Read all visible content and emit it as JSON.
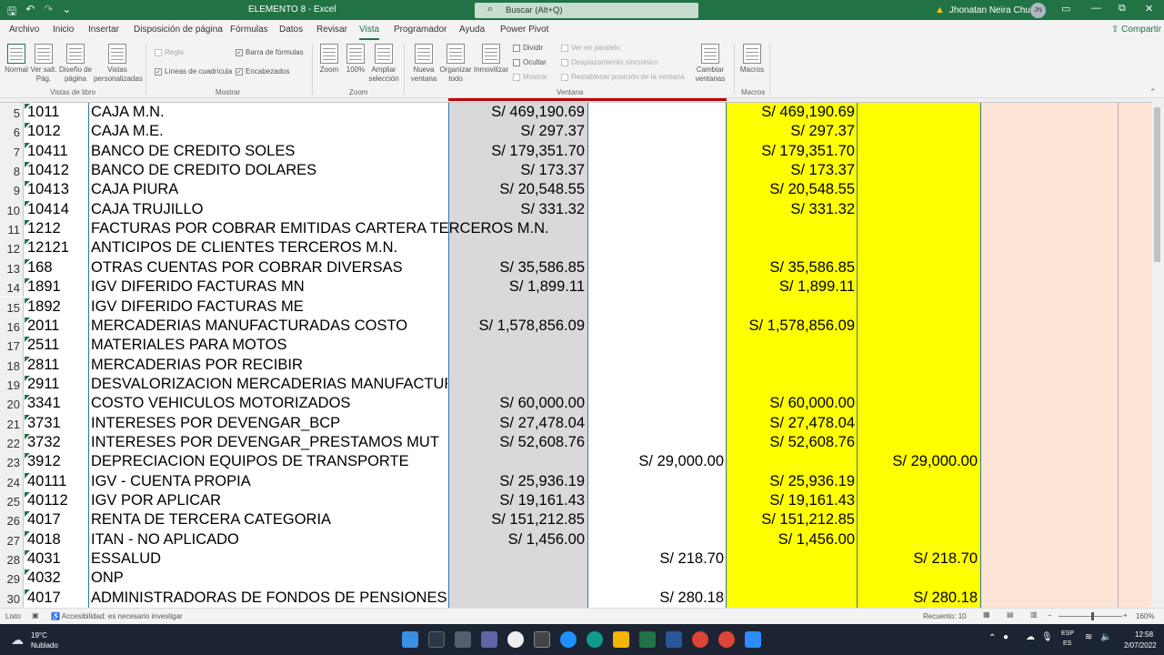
{
  "window": {
    "title": "ELEMENTO 8  -  Excel",
    "search_placeholder": "Buscar (Alt+Q)",
    "user_name": "Jhonatan Neira Chucas",
    "user_initials": "JN",
    "minimize": "—",
    "restore": "⧉",
    "close": "✕"
  },
  "menu": {
    "tabs": [
      "Archivo",
      "Inicio",
      "Insertar",
      "Disposición de página",
      "Fórmulas",
      "Datos",
      "Revisar",
      "Vista",
      "Programador",
      "Ayuda",
      "Power Pivot"
    ],
    "active": "Vista",
    "share": "Compartir"
  },
  "ribbon": {
    "vistas": {
      "normal": "Normal",
      "salto": "Ver salt. Pág.",
      "diseno": "Diseño de página",
      "personalizadas": "Vistas personalizadas",
      "group": "Vistas de libro"
    },
    "mostrar": {
      "regla": "Regla",
      "barra": "Barra de fórmulas",
      "lineas": "Líneas de cuadrícula",
      "encabezados": "Encabezados",
      "group": "Mostrar"
    },
    "zoom": {
      "zoom": "Zoom",
      "cien": "100%",
      "ampliar": "Ampliar selección",
      "group": "Zoom"
    },
    "ventana": {
      "nueva": "Nueva ventana",
      "organizar": "Organizar todo",
      "inmovilizar": "Inmovilizar",
      "dividir": "Dividir",
      "ocultar": "Ocultar",
      "mostrar": "Mostrar",
      "paralelo": "Ver en paralelo",
      "desplazamiento": "Desplazamiento sincrónico",
      "restablecer": "Restablecer posición de la ventana",
      "cambiar": "Cambiar ventanas",
      "group": "Ventana"
    },
    "macros": {
      "macros": "Macros",
      "group": "Macros"
    }
  },
  "rows": [
    {
      "n": "5",
      "code": "1011",
      "desc": "CAJA M.N.",
      "debe": "S/ 469,190.69",
      "haber": "",
      "saldo_d": "S/ 469,190.69",
      "saldo_h": ""
    },
    {
      "n": "6",
      "code": "1012",
      "desc": "CAJA M.E.",
      "debe": "S/ 297.37",
      "haber": "",
      "saldo_d": "S/ 297.37",
      "saldo_h": ""
    },
    {
      "n": "7",
      "code": "10411",
      "desc": "BANCO DE CREDITO SOLES",
      "debe": "S/ 179,351.70",
      "haber": "",
      "saldo_d": "S/ 179,351.70",
      "saldo_h": ""
    },
    {
      "n": "8",
      "code": "10412",
      "desc": "BANCO DE CREDITO DOLARES",
      "debe": "S/ 173.37",
      "haber": "",
      "saldo_d": "S/ 173.37",
      "saldo_h": ""
    },
    {
      "n": "9",
      "code": "10413",
      "desc": "CAJA PIURA",
      "debe": "S/ 20,548.55",
      "haber": "",
      "saldo_d": "S/ 20,548.55",
      "saldo_h": ""
    },
    {
      "n": "10",
      "code": "10414",
      "desc": "CAJA TRUJILLO",
      "debe": "S/ 331.32",
      "haber": "",
      "saldo_d": "S/ 331.32",
      "saldo_h": ""
    },
    {
      "n": "11",
      "code": "1212",
      "desc": "FACTURAS POR COBRAR EMITIDAS CARTERA TERCEROS M.N.",
      "debe": "",
      "haber": "",
      "saldo_d": "",
      "saldo_h": ""
    },
    {
      "n": "12",
      "code": "12121",
      "desc": "ANTICIPOS DE CLIENTES TERCEROS M.N.",
      "debe": "",
      "haber": "",
      "saldo_d": "",
      "saldo_h": ""
    },
    {
      "n": "13",
      "code": "168",
      "desc": "OTRAS CUENTAS POR COBRAR DIVERSAS",
      "debe": "S/ 35,586.85",
      "haber": "",
      "saldo_d": "S/ 35,586.85",
      "saldo_h": ""
    },
    {
      "n": "14",
      "code": "1891",
      "desc": "IGV DIFERIDO FACTURAS MN",
      "debe": "S/ 1,899.11",
      "haber": "",
      "saldo_d": "S/ 1,899.11",
      "saldo_h": ""
    },
    {
      "n": "15",
      "code": "1892",
      "desc": "IGV DIFERIDO FACTURAS ME",
      "debe": "",
      "haber": "",
      "saldo_d": "",
      "saldo_h": ""
    },
    {
      "n": "16",
      "code": "2011",
      "desc": "MERCADERIAS MANUFACTURADAS COSTO",
      "debe": "S/ 1,578,856.09",
      "haber": "",
      "saldo_d": "S/ 1,578,856.09",
      "saldo_h": ""
    },
    {
      "n": "17",
      "code": "2511",
      "desc": "MATERIALES PARA MOTOS",
      "debe": "",
      "haber": "",
      "saldo_d": "",
      "saldo_h": ""
    },
    {
      "n": "18",
      "code": "2811",
      "desc": "MERCADERIAS POR RECIBIR",
      "debe": "",
      "haber": "",
      "saldo_d": "",
      "saldo_h": ""
    },
    {
      "n": "19",
      "code": "2911",
      "desc": "DESVALORIZACION MERCADERIAS MANUFACTURADAS",
      "debe": "",
      "haber": "",
      "saldo_d": "",
      "saldo_h": ""
    },
    {
      "n": "20",
      "code": "3341",
      "desc": "COSTO VEHICULOS MOTORIZADOS",
      "debe": "S/ 60,000.00",
      "haber": "",
      "saldo_d": "S/ 60,000.00",
      "saldo_h": ""
    },
    {
      "n": "21",
      "code": "3731",
      "desc": "INTERESES POR DEVENGAR_BCP",
      "debe": "S/ 27,478.04",
      "haber": "",
      "saldo_d": "S/ 27,478.04",
      "saldo_h": ""
    },
    {
      "n": "22",
      "code": "3732",
      "desc": "INTERESES POR DEVENGAR_PRESTAMOS MUT",
      "debe": "S/ 52,608.76",
      "haber": "",
      "saldo_d": "S/ 52,608.76",
      "saldo_h": ""
    },
    {
      "n": "23",
      "code": "3912",
      "desc": "DEPRECIACION EQUIPOS DE TRANSPORTE",
      "debe": "",
      "haber": "S/ 29,000.00",
      "saldo_d": "",
      "saldo_h": "S/ 29,000.00"
    },
    {
      "n": "24",
      "code": "40111",
      "desc": "IGV - CUENTA PROPIA",
      "debe": "S/ 25,936.19",
      "haber": "",
      "saldo_d": "S/ 25,936.19",
      "saldo_h": ""
    },
    {
      "n": "25",
      "code": "40112",
      "desc": "IGV POR APLICAR",
      "debe": "S/ 19,161.43",
      "haber": "",
      "saldo_d": "S/ 19,161.43",
      "saldo_h": ""
    },
    {
      "n": "26",
      "code": "4017",
      "desc": "RENTA DE TERCERA CATEGORIA",
      "debe": "S/ 151,212.85",
      "haber": "",
      "saldo_d": "S/ 151,212.85",
      "saldo_h": ""
    },
    {
      "n": "27",
      "code": "4018",
      "desc": "ITAN - NO APLICADO",
      "debe": "S/ 1,456.00",
      "haber": "",
      "saldo_d": "S/ 1,456.00",
      "saldo_h": ""
    },
    {
      "n": "28",
      "code": "4031",
      "desc": "ESSALUD",
      "debe": "",
      "haber": "S/ 218.70",
      "saldo_d": "",
      "saldo_h": "S/ 218.70"
    },
    {
      "n": "29",
      "code": "4032",
      "desc": "ONP",
      "debe": "",
      "haber": "",
      "saldo_d": "",
      "saldo_h": ""
    },
    {
      "n": "30",
      "code": "4017",
      "desc": "ADMINISTRADORAS DE FONDOS DE PENSIONES",
      "debe": "",
      "haber": "S/ 280.18",
      "saldo_d": "",
      "saldo_h": "S/ 280.18"
    }
  ],
  "status": {
    "ready": "Listo",
    "accessibility": "Accesibilidad: es necesario investigar",
    "count": "Recuento: 10",
    "zoom": "160%"
  },
  "taskbar": {
    "temp": "19°C",
    "weather": "Nublado",
    "lang1": "ESP",
    "lang2": "ES",
    "time": "12:58",
    "date": "2/07/2022"
  },
  "colors": {
    "excel_green": "#217346",
    "yellow": "#ffff00",
    "gray": "#d9d9d9",
    "peach": "#fce4d6",
    "border_blue": "#2e75b6"
  }
}
